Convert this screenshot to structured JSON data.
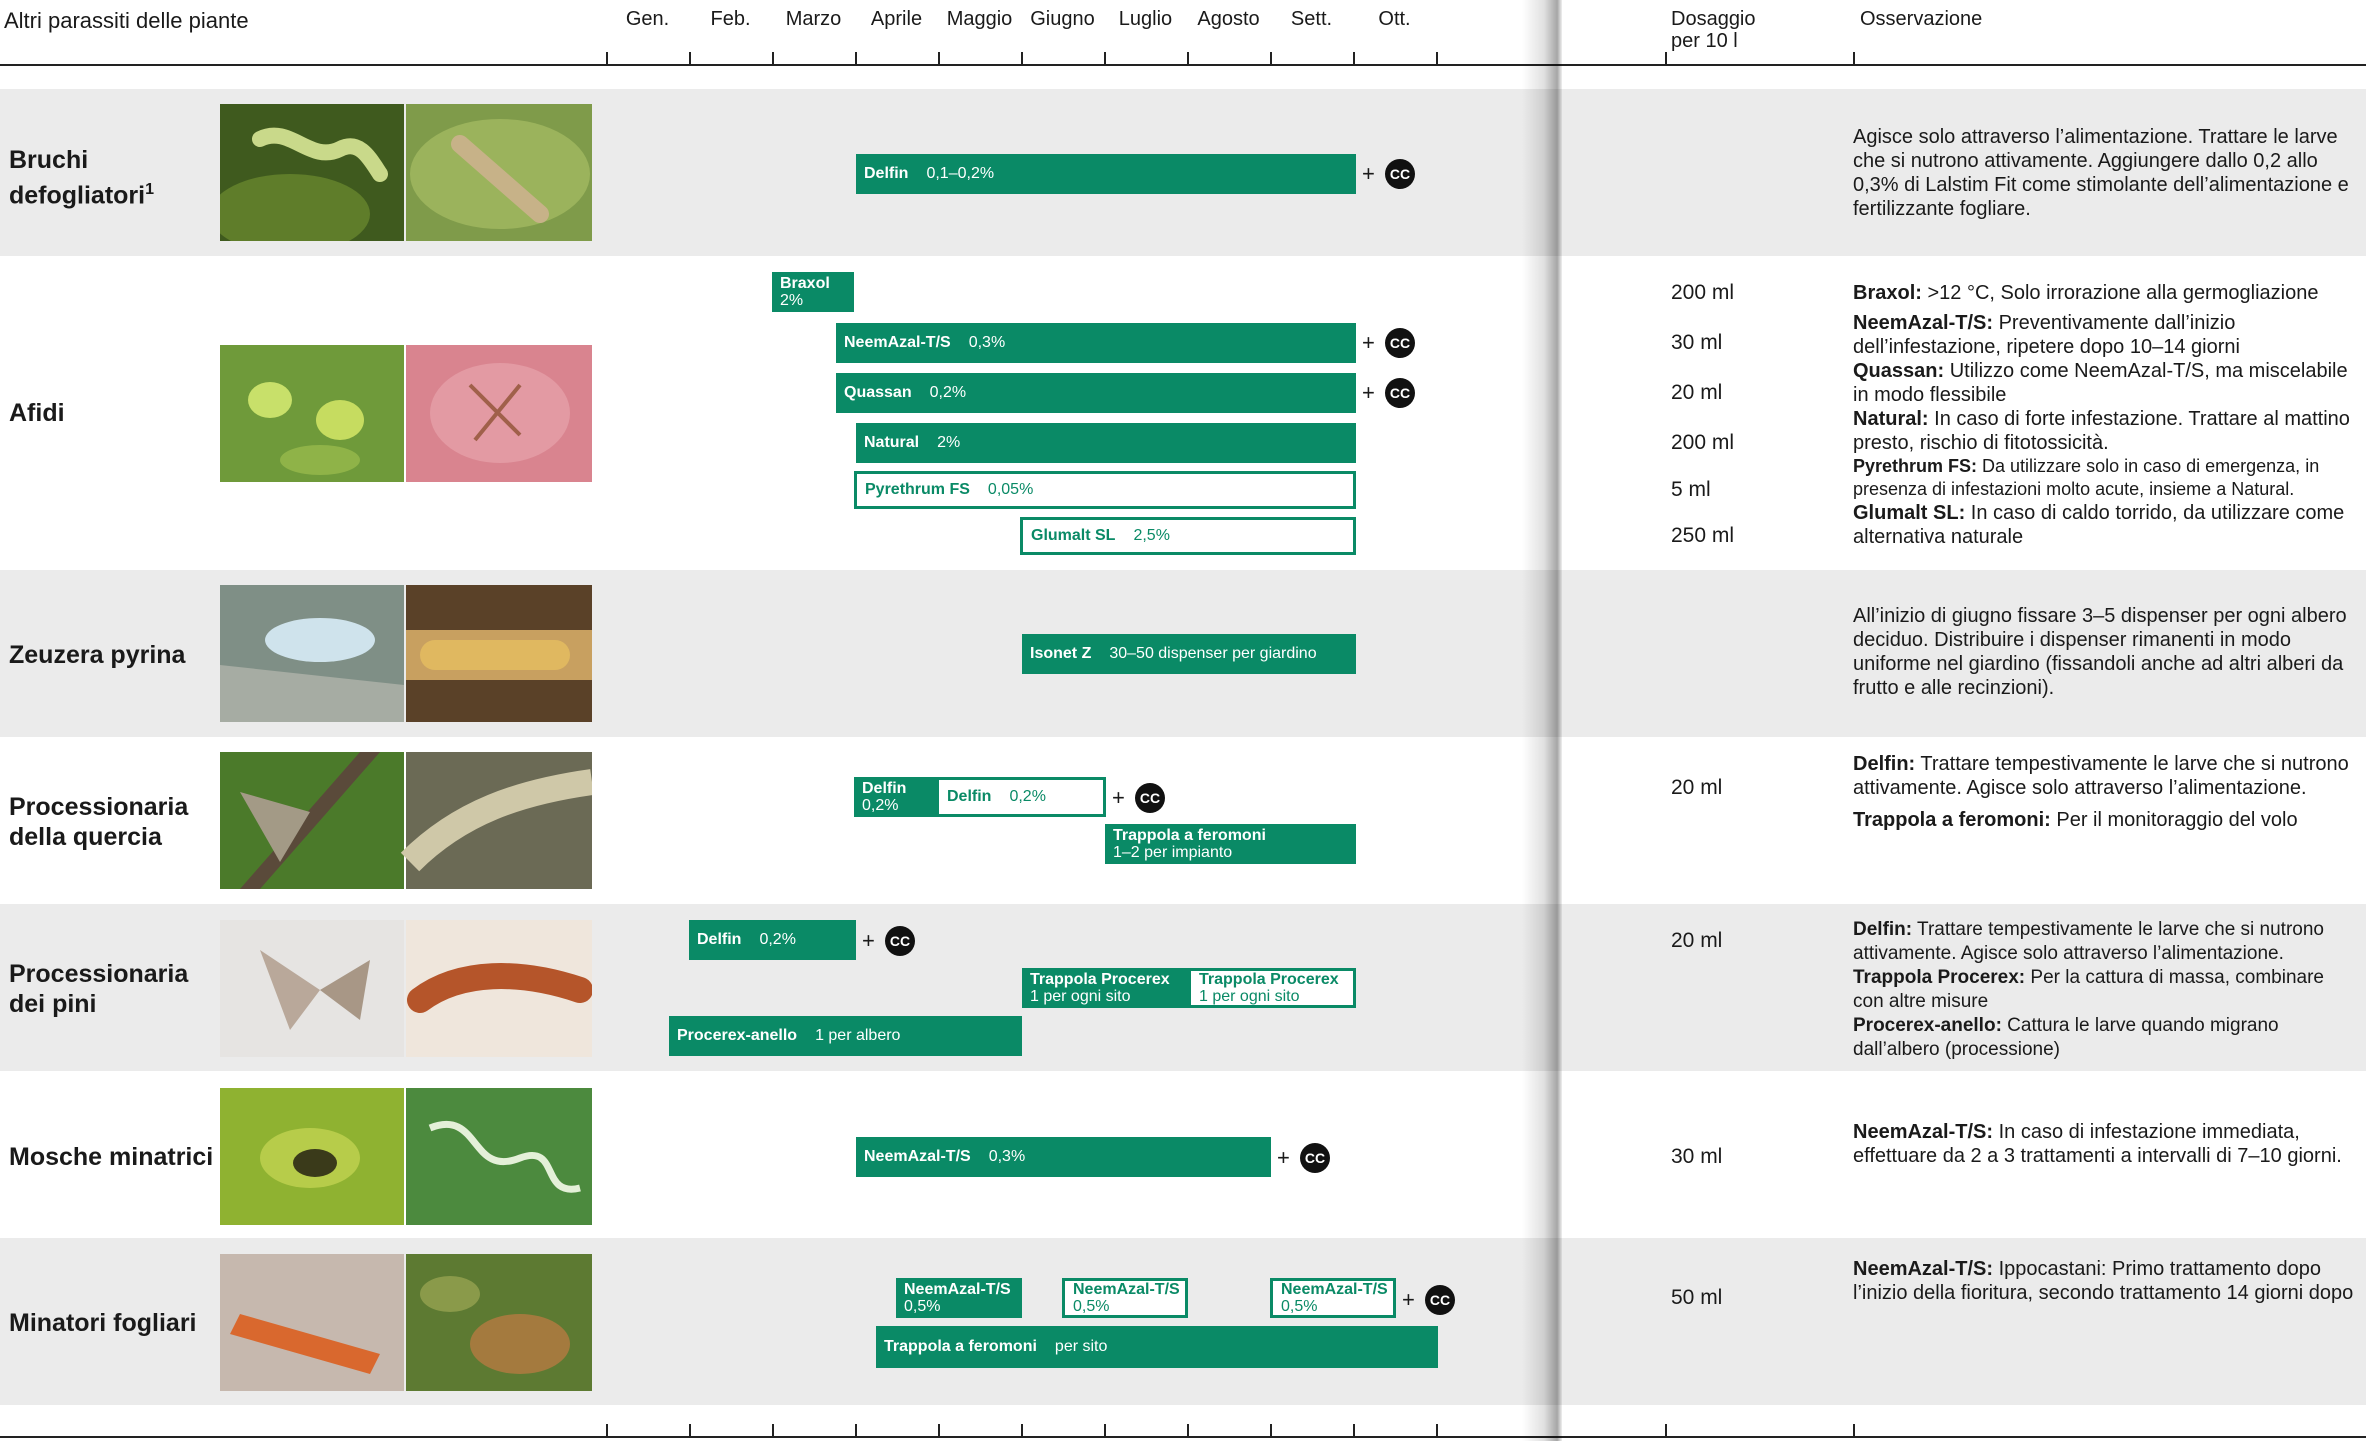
{
  "header": {
    "title": "Altri parassiti delle piante",
    "months": [
      "Gen.",
      "Feb.",
      "Marzo",
      "Aprile",
      "Maggio",
      "Giugno",
      "Luglio",
      "Agosto",
      "Sett.",
      "Ott."
    ],
    "dosage_line1": "Dosaggio",
    "dosage_line2": "per 10 l",
    "observation": "Osservazione"
  },
  "cc_label": "CC",
  "plus": "+",
  "pests": [
    {
      "name_line1": "Bruchi",
      "name_line2": "defogliatori",
      "footnote": "1",
      "bars": [
        {
          "name": "Delfin",
          "dose": "0,1–0,2%"
        }
      ],
      "observation": "Agisce solo attraverso l’alimentazione. Trattare le larve che si nutrono attivamente. Aggiungere dallo 0,2 allo 0,3% di Lalstim Fit come stimolante dell’alimentazione e fertilizzante fogliare."
    },
    {
      "name_line1": "Afidi",
      "bars": [
        {
          "name": "Braxol",
          "dose": "2%"
        },
        {
          "name": "NeemAzal-T/S",
          "dose": "0,3%"
        },
        {
          "name": "Quassan",
          "dose": "0,2%"
        },
        {
          "name": "Natural",
          "dose": "2%"
        },
        {
          "name": "Pyrethrum FS",
          "dose": "0,05%"
        },
        {
          "name": "Glumalt SL",
          "dose": "2,5%"
        }
      ],
      "dosages": [
        "200 ml",
        "30 ml",
        "20 ml",
        "200 ml",
        "5 ml",
        "250 ml"
      ],
      "notes": [
        {
          "label": "Braxol:",
          "text": " >12 °C, Solo irrorazione alla germogliazione"
        },
        {
          "label": "NeemAzal-T/S:",
          "text": " Preventivamente dall’inizio dell’infestazione, ripetere dopo 10–14 giorni"
        },
        {
          "label": "Quassan:",
          "text": " Utilizzo come NeemAzal-T/S, ma miscelabile in modo flessibile"
        },
        {
          "label": "Natural:",
          "text": " In caso di forte infestazione. Trattare al mattino presto, rischio di fitotossicità."
        },
        {
          "label": "Pyrethrum FS:",
          "text": " Da utilizzare solo in caso di emergenza, in presenza di infestazioni molto acute, insieme a Natural."
        },
        {
          "label": "Glumalt SL:",
          "text": " In caso di caldo torrido, da utilizzare come alternativa naturale"
        }
      ]
    },
    {
      "name_line1": "Zeuzera pyrina",
      "bars": [
        {
          "name": "Isonet Z",
          "dose": "30–50 dispenser per giardino"
        }
      ],
      "observation": "All’inizio di giugno fissare 3–5 dispenser per ogni albero deciduo. Distribuire i dispenser rimanenti in modo uniforme nel giardino (fissandoli anche ad altri alberi da frutto e alle recinzioni)."
    },
    {
      "name_line1": "Processionaria",
      "name_line2": "della quercia",
      "bars": [
        {
          "name": "Delfin",
          "dose": "0,2%"
        },
        {
          "name": "Delfin",
          "dose": "0,2%"
        },
        {
          "name": "Trappola a feromoni",
          "dose": "1–2 per impianto"
        }
      ],
      "dosages": [
        "20 ml"
      ],
      "notes": [
        {
          "label": "Delfin:",
          "text": " Trattare tempestivamente le larve che si nutrono attivamente. Agisce solo attraverso l’alimentazione."
        },
        {
          "label": "Trappola a feromoni:",
          "text": " Per il monitoraggio del volo"
        }
      ]
    },
    {
      "name_line1": "Processionaria",
      "name_line2": "dei pini",
      "bars": [
        {
          "name": "Delfin",
          "dose": "0,2%"
        },
        {
          "name": "Trappola Procerex",
          "dose": "1 per ogni sito"
        },
        {
          "name": "Trappola Procerex",
          "dose": "1 per ogni sito"
        },
        {
          "name": "Procerex-anello",
          "dose": "1 per albero"
        }
      ],
      "dosages": [
        "20 ml"
      ],
      "notes": [
        {
          "label": "Delfin:",
          "text": " Trattare tempestivamente le larve che si nutrono attivamente. Agisce solo attraverso l’alimentazione."
        },
        {
          "label": "Trappola Procerex:",
          "text": " Per la cattura di massa, combinare con altre misure"
        },
        {
          "label": "Procerex-anello:",
          "text": " Cattura le larve quando migrano dall’albero (processione)"
        }
      ]
    },
    {
      "name_line1": "Mosche minatrici",
      "bars": [
        {
          "name": "NeemAzal-T/S",
          "dose": "0,3%"
        }
      ],
      "dosages": [
        "30 ml"
      ],
      "notes": [
        {
          "label": "NeemAzal-T/S:",
          "text": " In caso di infestazione immediata, effettuare da 2 a 3 trattamenti a intervalli di 7–10 giorni."
        }
      ]
    },
    {
      "name_line1": "Minatori fogliari",
      "bars": [
        {
          "name": "NeemAzal-T/S",
          "dose": "0,5%"
        },
        {
          "name": "NeemAzal-T/S",
          "dose": "0,5%"
        },
        {
          "name": "NeemAzal-T/S",
          "dose": "0,5%"
        },
        {
          "name": "Trappola a feromoni",
          "dose": "per sito"
        }
      ],
      "dosages": [
        "50 ml"
      ],
      "notes": [
        {
          "label": "NeemAzal-T/S:",
          "text": " Ippocastani: Primo trattamento dopo l’inizio della fioritura, secondo trattamento 14 giorni dopo"
        }
      ]
    }
  ],
  "colors": {
    "green": "#0a8a66",
    "band": "#ebebeb",
    "cc": "#111111"
  },
  "icons": {
    "cc_badge": "cc-badge-icon"
  }
}
